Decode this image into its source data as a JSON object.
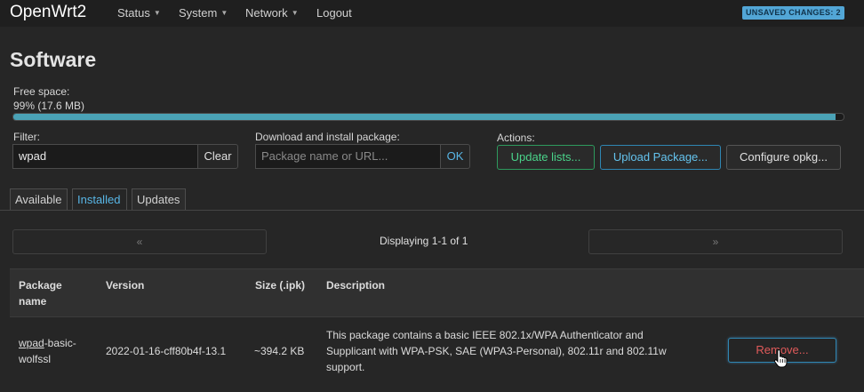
{
  "header": {
    "brand": "OpenWrt2",
    "nav": [
      {
        "label": "Status",
        "has_dropdown": true
      },
      {
        "label": "System",
        "has_dropdown": true
      },
      {
        "label": "Network",
        "has_dropdown": true
      },
      {
        "label": "Logout",
        "has_dropdown": false
      }
    ],
    "unsaved_badge": "UNSAVED CHANGES: 2"
  },
  "page": {
    "title": "Software",
    "free_space_label": "Free space:",
    "free_space_value": "99% (17.6 MB)",
    "free_space_percent": 99
  },
  "filter": {
    "label": "Filter:",
    "value": "wpad",
    "clear_label": "Clear"
  },
  "download": {
    "label": "Download and install package:",
    "placeholder": "Package name or URL...",
    "ok_label": "OK"
  },
  "actions": {
    "label": "Actions:",
    "update_lists": "Update lists...",
    "upload_package": "Upload Package...",
    "configure_opkg": "Configure opkg..."
  },
  "tabs": [
    {
      "label": "Available",
      "active": false
    },
    {
      "label": "Installed",
      "active": true
    },
    {
      "label": "Updates",
      "active": false
    }
  ],
  "pager": {
    "prev": "«",
    "next": "»",
    "status": "Displaying 1-1 of 1"
  },
  "table": {
    "headers": {
      "package_name_line1": "Package",
      "package_name_line2": "name",
      "version": "Version",
      "size": "Size (.ipk)",
      "description": "Description"
    },
    "rows": [
      {
        "name_link": "wpad",
        "name_rest_line1": "-basic-",
        "name_line2": "wolfssl",
        "version": "2022-01-16-cff80b4f-13.1",
        "size": "~394.2 KB",
        "description_line1": "This package contains a basic IEEE 802.1x/WPA Authenticator and",
        "description_line2": "Supplicant with WPA-PSK, SAE (WPA3-Personal), 802.11r and 802.11w",
        "description_line3": "support.",
        "remove_label": "Remove..."
      }
    ]
  },
  "colors": {
    "accent_blue": "#58b6e6",
    "green": "#4ad38a",
    "danger_red": "#e05a5a",
    "progress": "#4aa2b6"
  }
}
